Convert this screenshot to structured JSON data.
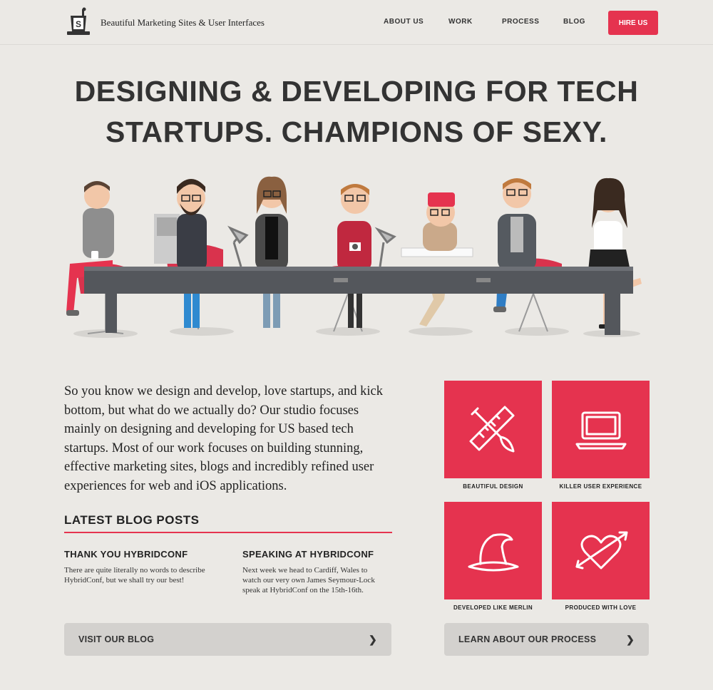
{
  "header": {
    "tagline": "Beautiful Marketing Sites & User Interfaces",
    "nav": [
      {
        "label": "ABOUT US"
      },
      {
        "label": "WORK"
      },
      {
        "label": "PROCESS"
      },
      {
        "label": "BLOG"
      }
    ],
    "cta_label": "HIRE US"
  },
  "hero": {
    "headline_line1": "DESIGNING & DEVELOPING FOR TECH",
    "headline_line2": "STARTUPS. CHAMPIONS OF SEXY."
  },
  "intro": {
    "text": "So you know we design and develop, love startups, and kick bottom, but what do we actually do? Our studio focuses mainly on designing and developing for US based tech startups. Most of our work focuses on building stunning, effective marketing sites, blogs and incredibly refined user experiences for web and iOS applications."
  },
  "blog": {
    "heading": "LATEST BLOG POSTS",
    "posts": [
      {
        "title": "THANK YOU HYBRIDCONF",
        "excerpt": "There are quite literally no words to describe HybridConf, but we shall try our best!"
      },
      {
        "title": "SPEAKING AT HYBRIDCONF",
        "excerpt": "Next week we head to Cardiff, Wales to watch our very own James Seymour-Lock speak at HybridConf on the 15th-16th."
      }
    ],
    "button_label": "VISIT OUR BLOG"
  },
  "services": {
    "tiles": [
      {
        "label": "BEAUTIFUL DESIGN",
        "icon": "ruler-brush-icon"
      },
      {
        "label": "KILLER USER EXPERIENCE",
        "icon": "laptop-icon"
      },
      {
        "label": "DEVELOPED LIKE MERLIN",
        "icon": "wizard-hat-icon"
      },
      {
        "label": "PRODUCED WITH LOVE",
        "icon": "heart-arrow-icon"
      }
    ],
    "button_label": "LEARN ABOUT OUR PROCESS"
  },
  "colors": {
    "accent": "#e5334f",
    "background": "#ebe9e5",
    "button_gray": "#d3d1ce",
    "text": "#333333"
  }
}
